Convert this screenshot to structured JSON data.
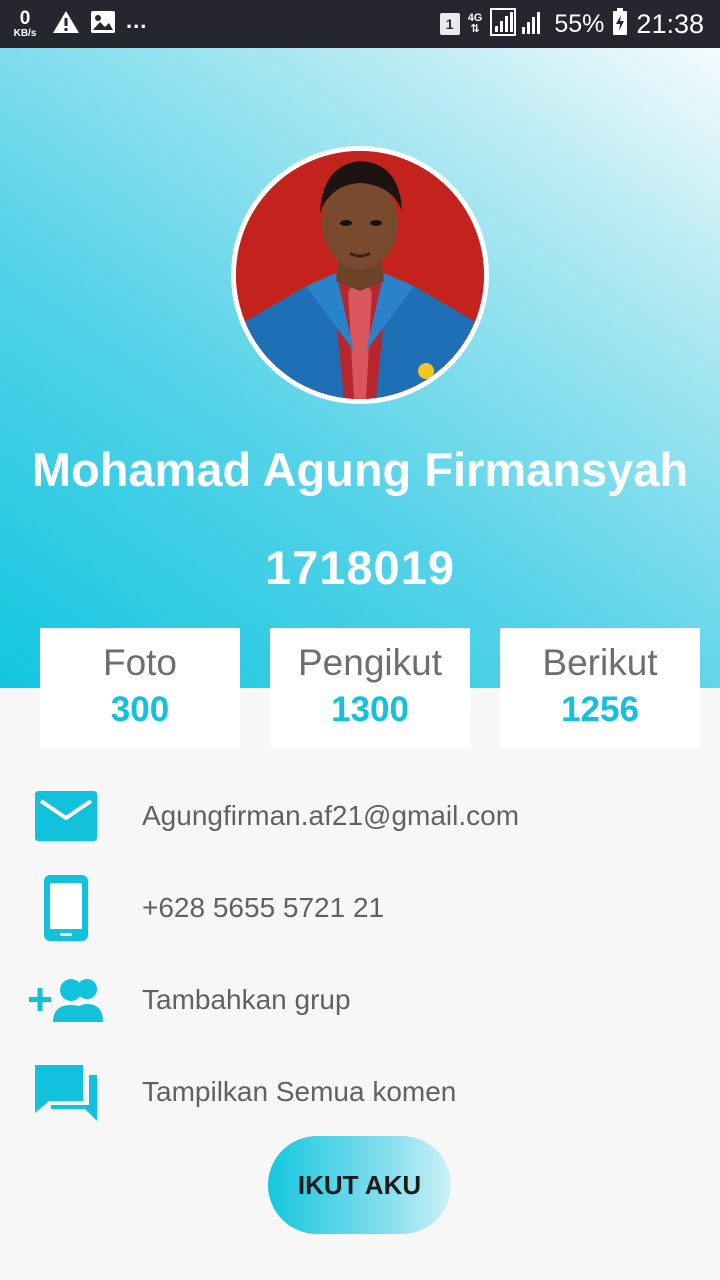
{
  "status_bar": {
    "speed_value": "0",
    "speed_unit": "KB/s",
    "overflow": "...",
    "sim_slot": "1",
    "network": "4G",
    "battery": "55%",
    "time": "21:38",
    "icons": [
      "warning-icon",
      "image-icon",
      "signal-icon",
      "battery-charging-icon"
    ]
  },
  "profile": {
    "name": "Mohamad Agung Firmansyah",
    "id_number": "1718019",
    "avatar": "profile-photo"
  },
  "stats": [
    {
      "label": "Foto",
      "value": "300"
    },
    {
      "label": "Pengikut",
      "value": "1300"
    },
    {
      "label": "Berikut",
      "value": "1256"
    }
  ],
  "info": {
    "email": "Agungfirman.af21@gmail.com",
    "phone": "+628 5655 5721 21",
    "group": "Tambahkan grup",
    "comments": "Tampilkan Semua komen"
  },
  "follow_button": "IKUT AKU",
  "colors": {
    "accent": "#12c2dc",
    "text_gray": "#616161",
    "status_bar": "#26262f"
  }
}
